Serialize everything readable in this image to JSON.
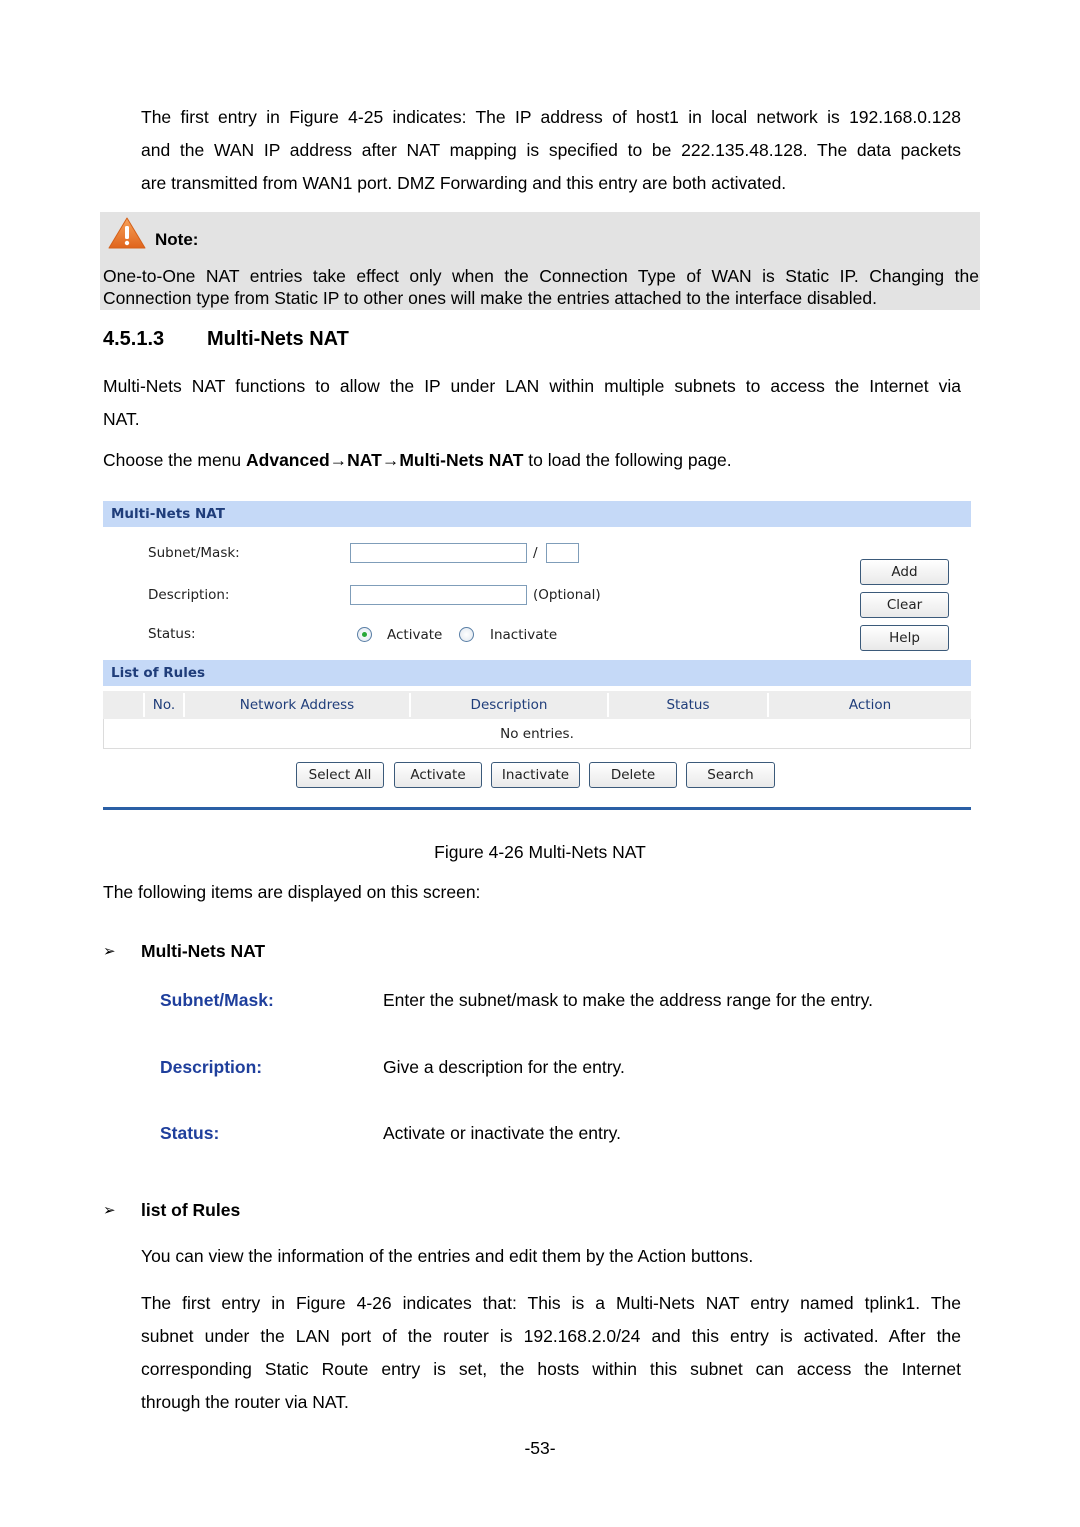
{
  "intro_paragraph": [
    "The first entry in Figure 4-25 indicates: The IP address of host1 in local network is 192.168.0.128",
    "and the WAN IP address after NAT mapping is specified to be 222.135.48.128. The data packets",
    "are transmitted from WAN1 port. DMZ Forwarding and this entry are both activated."
  ],
  "note": {
    "icon": "warning-icon",
    "title": "Note:",
    "lines": [
      "One-to-One NAT entries take effect only when the Connection Type of WAN is Static IP. Changing the",
      "Connection type from Static IP to other ones will make the entries attached to the interface disabled."
    ]
  },
  "section": {
    "number": "4.5.1.3",
    "title": "Multi-Nets NAT",
    "description_lines": [
      "Multi-Nets NAT functions to allow the IP under LAN within multiple subnets to access the Internet via",
      "NAT."
    ],
    "menu_prefix": "Choose the menu ",
    "menu_path": "Advanced→NAT→Multi-Nets NAT",
    "menu_suffix": " to load the following page."
  },
  "ui": {
    "form_header": "Multi-Nets NAT",
    "fields": {
      "subnet_label": "Subnet/Mask:",
      "subnet_value": "",
      "mask_separator": "/",
      "mask_value": "",
      "description_label": "Description:",
      "description_value": "",
      "optional_hint": "(Optional)",
      "status_label": "Status:",
      "status_options": [
        "Activate",
        "Inactivate"
      ],
      "status_selected": "Activate"
    },
    "side_buttons": [
      "Add",
      "Clear",
      "Help"
    ],
    "list_header": "List of Rules",
    "table_columns": [
      "No.",
      "Network Address",
      "Description",
      "Status",
      "Action"
    ],
    "empty_message": "No entries.",
    "bottom_buttons": [
      "Select All",
      "Activate",
      "Inactivate",
      "Delete",
      "Search"
    ]
  },
  "figure_caption": "Figure 4-26 Multi-Nets NAT",
  "items_intro": "The following items are displayed on this screen:",
  "bullet_multinets": {
    "arrow": "➢",
    "heading": "Multi-Nets NAT",
    "definitions": [
      {
        "term": "Subnet/Mask:",
        "desc": "Enter the subnet/mask to make the address range for the entry."
      },
      {
        "term": "Description:",
        "desc": "Give a description for the entry."
      },
      {
        "term": "Status:",
        "desc": "Activate or inactivate the entry."
      }
    ]
  },
  "bullet_rules": {
    "arrow": "➢",
    "heading": "list of Rules",
    "text": "You can view the information of the entries and edit them by the Action buttons.",
    "paragraph_lines": [
      "The first entry in Figure 4-26 indicates that: This is a Multi-Nets NAT entry named tplink1. The",
      "subnet under the LAN port of the router is 192.168.2.0/24 and this entry is activated. After the",
      "corresponding Static Route entry is set, the hosts within this subnet can access the Internet",
      "through the router via NAT."
    ]
  },
  "page_number": "-53-",
  "colors": {
    "term_blue": "#1f3f9c",
    "panel_header_bg": "#c5d9f7",
    "note_bg": "#e3e3e3",
    "warning_orange": "#e8742a"
  }
}
